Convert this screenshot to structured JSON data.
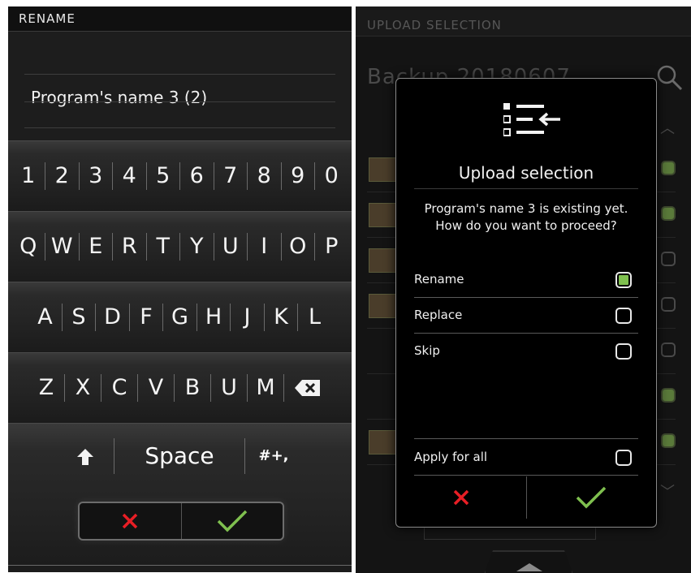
{
  "left": {
    "header": "RENAME",
    "name_value": "Program's name 3 (2)",
    "keyboard": {
      "numbers": [
        "1",
        "2",
        "3",
        "4",
        "5",
        "6",
        "7",
        "8",
        "9",
        "0"
      ],
      "row_q": [
        "Q",
        "W",
        "E",
        "R",
        "T",
        "Y",
        "U",
        "I",
        "O",
        "P"
      ],
      "row_a": [
        "A",
        "S",
        "D",
        "F",
        "G",
        "H",
        "J",
        "K",
        "L"
      ],
      "row_z": [
        "Z",
        "X",
        "C",
        "V",
        "B",
        "U",
        "M"
      ],
      "space_label": "Space",
      "symbols_label": "#+,"
    },
    "icons": [
      "shift-icon",
      "backspace-icon",
      "cancel-icon",
      "confirm-icon"
    ],
    "colors": {
      "cancel": "#e81e25",
      "confirm": "#7fc04f"
    }
  },
  "right": {
    "header": "UPLOAD SELECTION",
    "background_title": "Backup 20180607",
    "dialog": {
      "title": "Upload selection",
      "message_line1": "Program's name 3 is existing yet.",
      "message_line2": "How do you want to proceed?",
      "options": [
        {
          "label": "Rename",
          "checked": true
        },
        {
          "label": "Replace",
          "checked": false
        },
        {
          "label": "Skip",
          "checked": false
        }
      ],
      "apply_all": {
        "label": "Apply for all",
        "checked": false
      }
    },
    "icons": [
      "list-upload-icon",
      "search-icon",
      "chevron-up-icon",
      "chevron-down-icon",
      "cancel-icon",
      "confirm-icon"
    ]
  }
}
